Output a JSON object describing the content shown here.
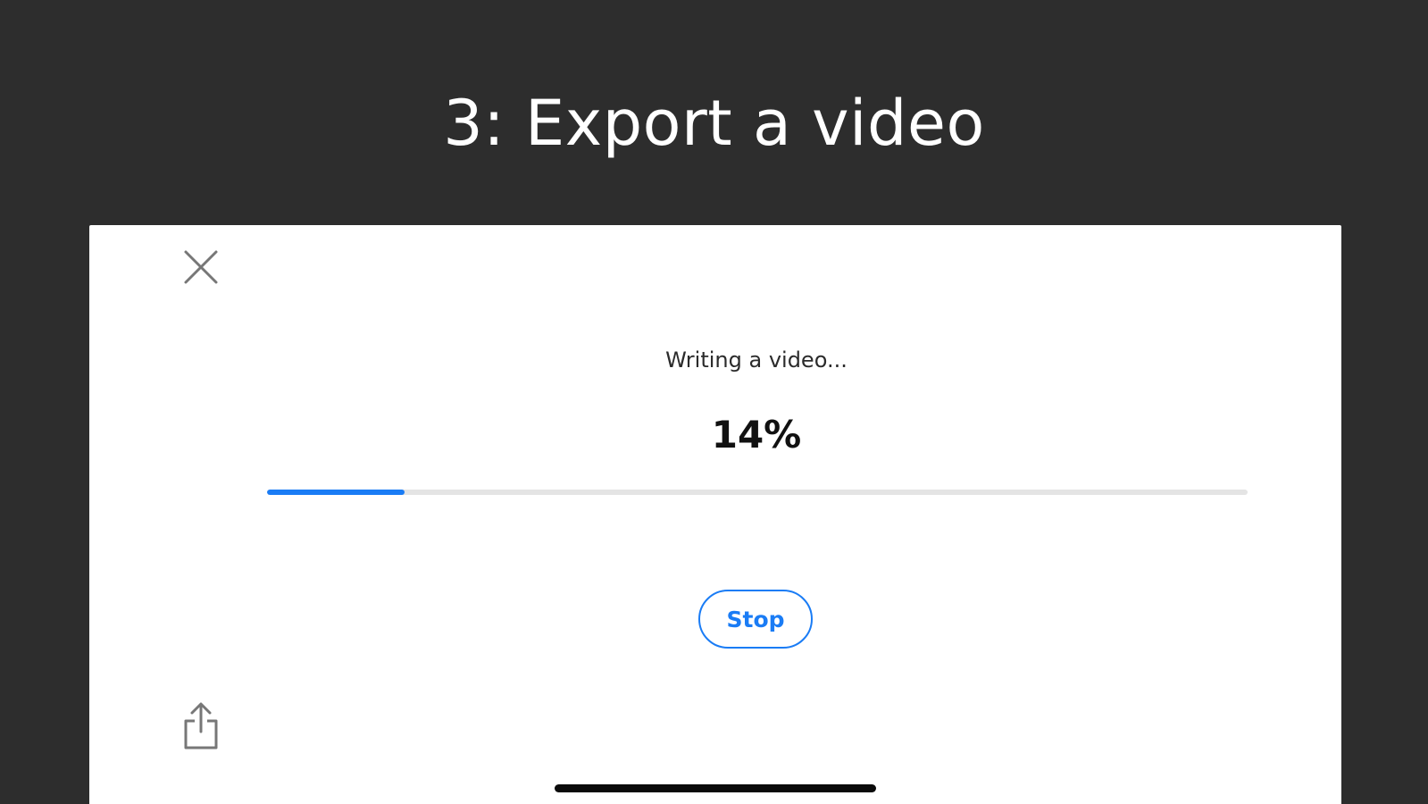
{
  "header": {
    "title": "3: Export a video"
  },
  "export_dialog": {
    "close_icon": "close-x-icon",
    "status_text": "Writing a video...",
    "progress_label": "14%",
    "progress_value": 0.14,
    "stop_label": "Stop",
    "share_icon": "share-icon"
  },
  "colors": {
    "background": "#2d2d2d",
    "accent": "#1a7cf5",
    "track": "#e4e4e4",
    "screen": "#ffffff"
  }
}
